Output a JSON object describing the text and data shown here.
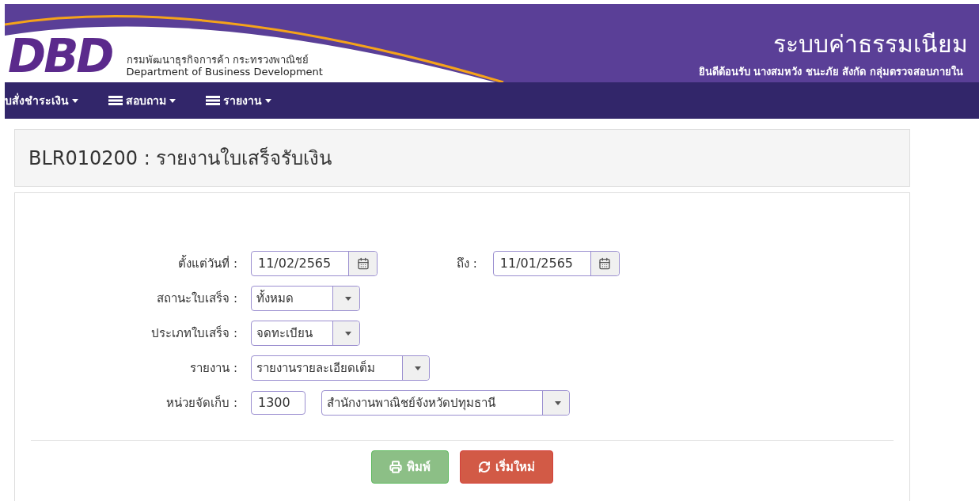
{
  "header": {
    "logo_text": "DBD",
    "org_th": "กรมพัฒนาธุรกิจการค้า กระทรวงพาณิชย์",
    "org_en": "Department of Business Development",
    "system_title": "ระบบค่าธรรมเนียม",
    "welcome": "ยินดีต้อนรับ นางสมหวัง ชนะภัย สังกัด กลุ่มตรวจสอบภายใน"
  },
  "nav": [
    {
      "label": "บสั่งชำระเงิน",
      "kind": "plain"
    },
    {
      "label": "สอบถาม",
      "kind": "list"
    },
    {
      "label": "รายงาน",
      "kind": "list"
    }
  ],
  "page_title": "BLR010200 : รายงานใบเสร็จรับเงิน",
  "form": [
    {
      "kind": "date-range",
      "label": "ตั้งแต่วันที่ :",
      "value": "11/02/2565",
      "to_label": "ถึง :",
      "to_value": "11/01/2565"
    },
    {
      "kind": "select",
      "label": "สถานะใบเสร็จ :",
      "value": "ทั้งหมด"
    },
    {
      "kind": "select",
      "label": "ประเภทใบเสร็จ :",
      "value": "จดทะเบียน"
    },
    {
      "kind": "select",
      "label": "รายงาน :",
      "value": "รายงานรายละเอียดเต็ม"
    },
    {
      "kind": "code-select",
      "label": "หน่วยจัดเก็บ :",
      "code": "1300",
      "value": "สำนักงานพาณิชย์จังหวัดปทุมธานี"
    }
  ],
  "buttons": [
    {
      "label": "พิมพ์",
      "kind": "print"
    },
    {
      "label": "เริ่มใหม่",
      "kind": "reset"
    }
  ]
}
